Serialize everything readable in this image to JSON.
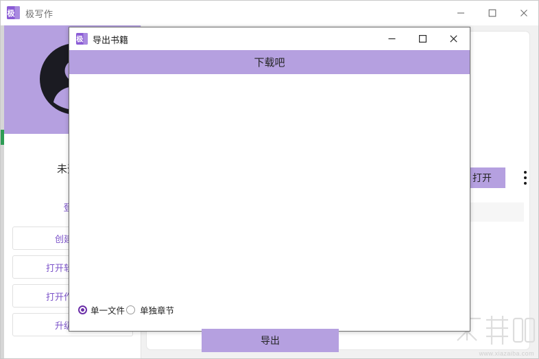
{
  "main_window": {
    "title": "极写作",
    "app_icon": "app-logo-icon",
    "controls": {
      "minimize": "minimize-icon",
      "maximize": "maximize-icon",
      "close": "close-icon"
    },
    "sidebar": {
      "avatar": "user-avatar-icon",
      "username": "未登录",
      "login_link": "登录",
      "buttons": [
        {
          "label": "创建作品"
        },
        {
          "label": "打开软件目录"
        },
        {
          "label": "打开作品目录"
        },
        {
          "label": "升级会员"
        }
      ]
    },
    "content": {
      "open_button": "打开",
      "more_menu": "more-vertical-icon"
    },
    "watermark": {
      "logo": "下载吧",
      "url": "www.xiazaiba.com"
    }
  },
  "export_dialog": {
    "title": "导出书籍",
    "app_icon": "app-logo-icon",
    "banner": "下载吧",
    "controls": {
      "minimize": "minimize-icon",
      "maximize": "maximize-icon",
      "close": "close-icon"
    },
    "radio_options": [
      {
        "label": "单一文件",
        "selected": true
      },
      {
        "label": "单独章节",
        "selected": false
      }
    ],
    "export_button": "导出"
  },
  "colors": {
    "accent_purple": "#b5a0e0",
    "link_purple": "#7b52c9",
    "radio_purple": "#6b2ea8",
    "window_bg": "#f1f1f1",
    "rail_green": "#2e9c55"
  }
}
